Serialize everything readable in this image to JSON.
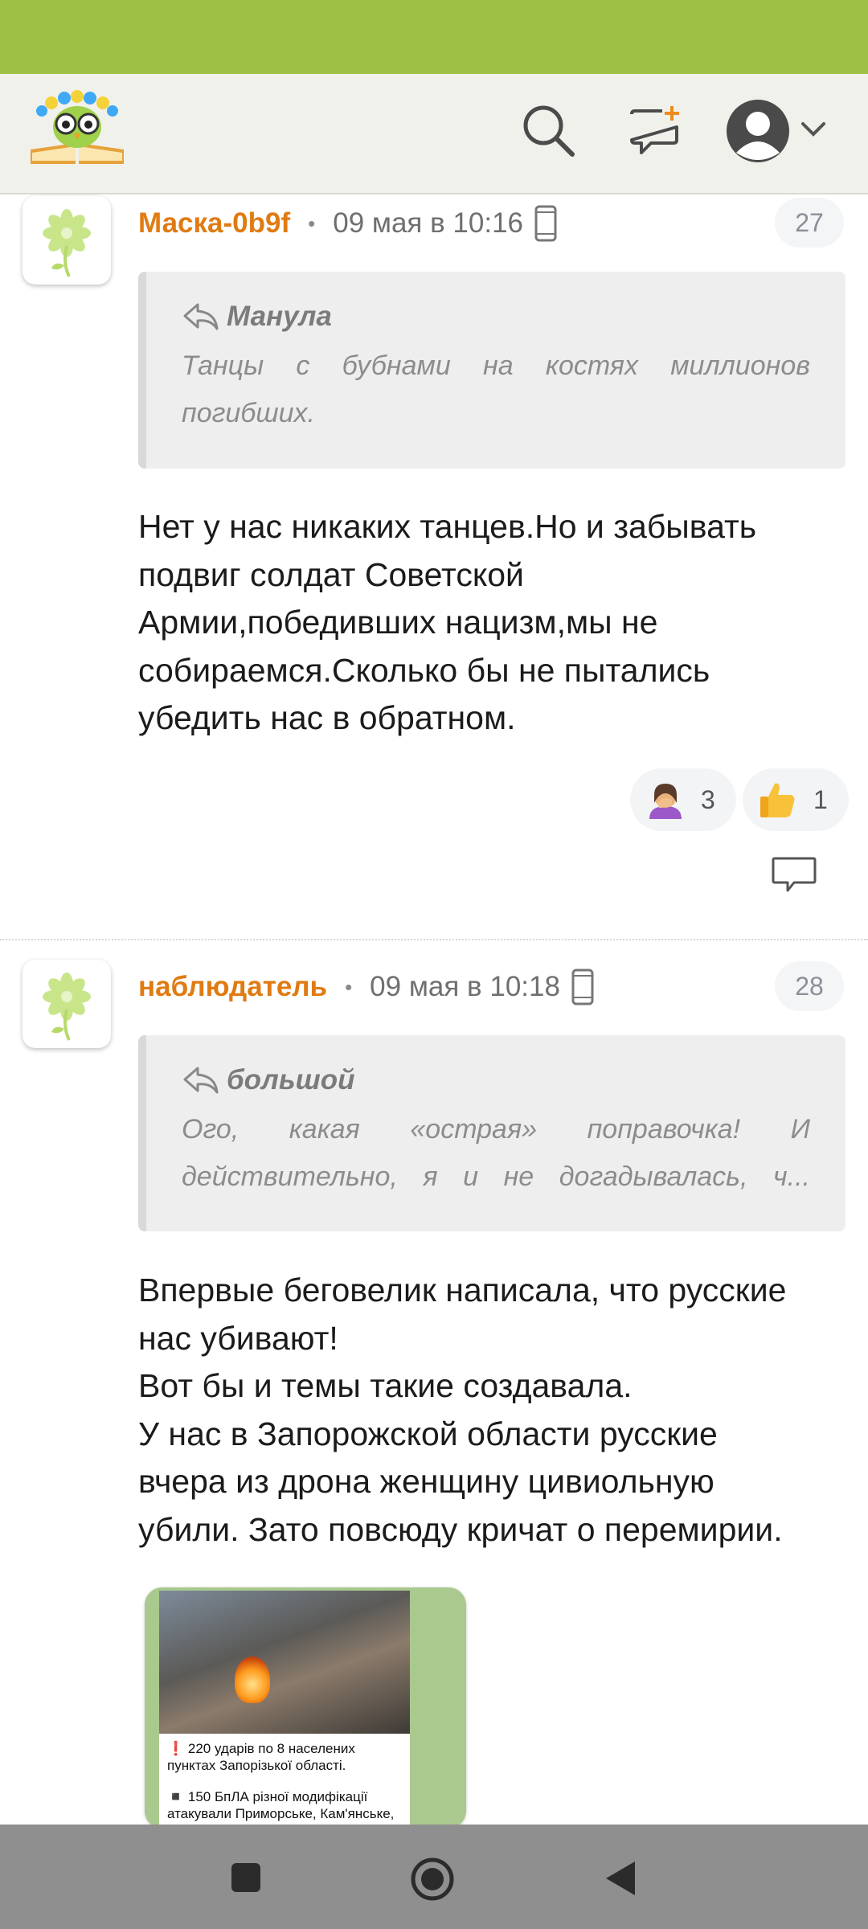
{
  "header": {
    "logo": "book-owl-logo",
    "icons": [
      "search-icon",
      "new-message-icon",
      "profile-icon",
      "chevron-down-icon"
    ]
  },
  "comments": [
    {
      "author": "Маска-0b9f",
      "separator": "•",
      "time": "09 мая в 10:16",
      "number": "27",
      "quote_author": "Манула",
      "quote_text": "Танцы с бубнами на костях миллионов погибших.",
      "body": "Нет у нас никаких танцев.Но и забывать\nподвиг солдат Советской\nАрмии,победивших нацизм,мы не\nсобираемся.Сколько бы не пытались\nубедить нас в обратном.",
      "reactions": [
        {
          "icon": "facepalm-icon",
          "count": "3"
        },
        {
          "icon": "thumbs-up-icon",
          "count": "1"
        }
      ]
    },
    {
      "author": "наблюдатель",
      "separator": "•",
      "time": "09 мая в 10:18",
      "number": "28",
      "quote_author": "большой",
      "quote_text": "Ого, какая «острая» поправочка! И действительно, я и не догадывалась, ч...",
      "body": "Впервые беговелик написала, что русские\nнас убивают!\nВот бы и темы такие создавала.\nУ нас в Запорожской области русские\nвчера из дрона женщину цивиольную\nубили. Зато повсюду кричат о перемирии.",
      "attachment": {
        "line1": "❗ 220 ударів по 8 населених пунктах Запорізької області.",
        "line2": "◾ 150 БпЛА різної модифікації атакували Приморське, Кам'янське,"
      }
    }
  ],
  "colors": {
    "status_bar": "#9ec145",
    "author": "#e07b12",
    "header_bg": "#f1f1ec"
  }
}
